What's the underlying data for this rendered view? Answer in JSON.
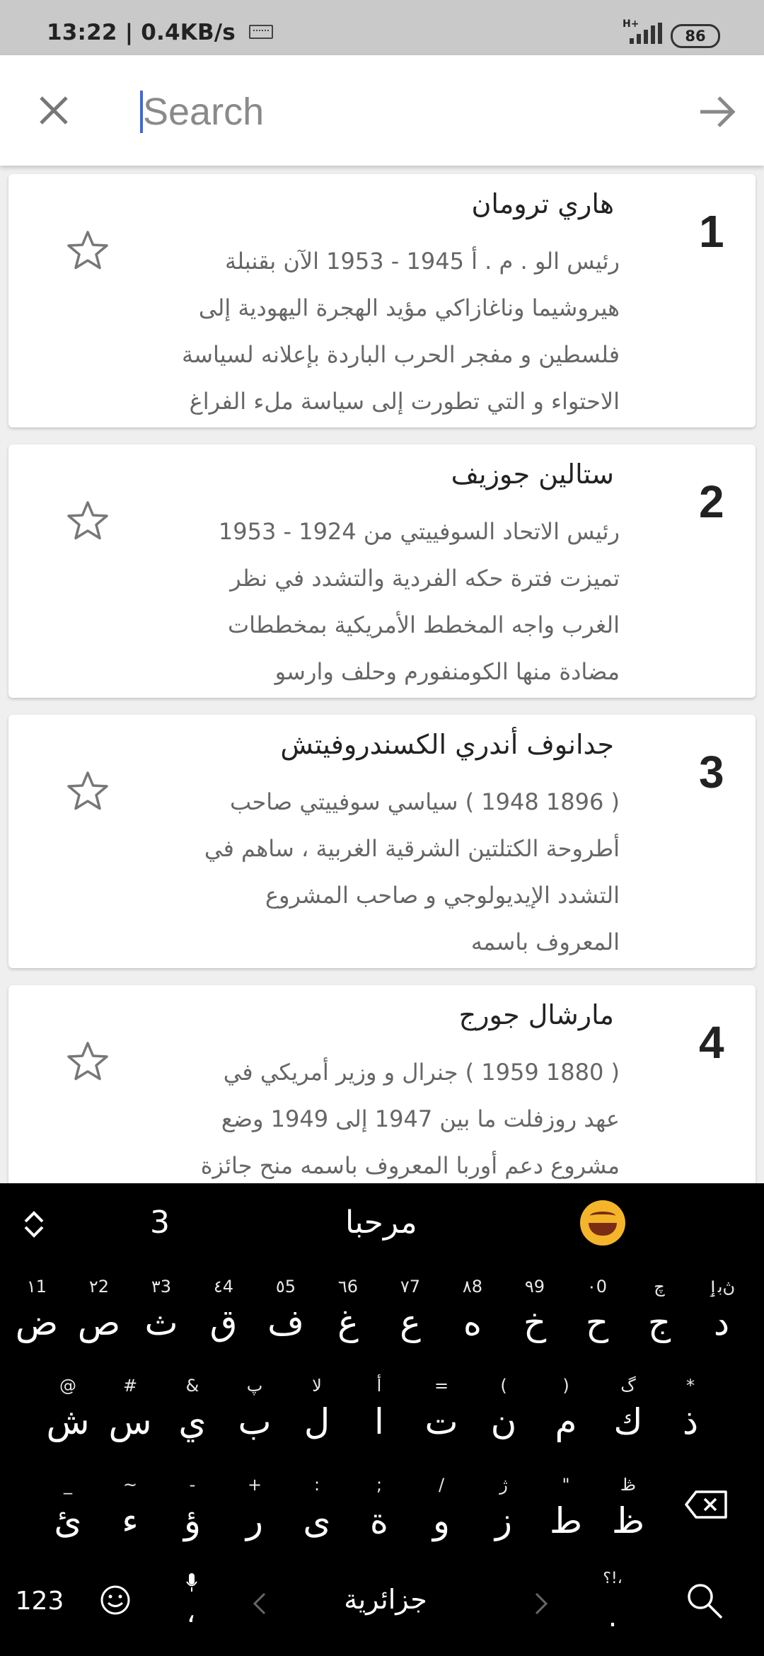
{
  "status_bar": {
    "time": "13:22",
    "speed": "0.4KB/s",
    "network": "H+",
    "battery": "86"
  },
  "search": {
    "placeholder": "Search"
  },
  "results": [
    {
      "rank": "1",
      "title": "هاري ترومان",
      "lines": [
        "رئيس الو . م . أ 1945 - 1953 الآن بقنبلة",
        "هيروشيما وناغازاكي مؤيد الهجرة اليهودية إلى",
        "فلسطين و مفجر الحرب الباردة بإعلانه لسياسة",
        "الاحتواء و التي تطورت إلى سياسة ملء الفراغ"
      ]
    },
    {
      "rank": "2",
      "title": "ستالين جوزيف",
      "lines": [
        "رئيس الاتحاد السوفييتي من 1924 - 1953",
        "تميزت فترة حكه الفردية والتشدد في نظر",
        "الغرب واجه المخطط الأمريكية بمخططات",
        "مضادة منها الكومنفورم وحلف وارسو"
      ]
    },
    {
      "rank": "3",
      "title": "جدانوف أندري الكسندروفيتش",
      "lines": [
        "( 1896 1948 ) سياسي سوفييتي صاحب",
        "أطروحة الكتلتين الشرقية الغربية ، ساهم في",
        "التشدد الإيديولوجي و صاحب المشروع",
        "المعروف باسمه"
      ]
    },
    {
      "rank": "4",
      "title": "مارشال جورج",
      "lines": [
        "( 1880 1959 ) جنرال و وزير أمريكي في",
        "عهد روزفلت ما بين 1947 إلى 1949 وضع",
        "مشروع دعم أوربا المعروف باسمه منح جائزة"
      ]
    }
  ],
  "keyboard": {
    "suggestions": [
      "3",
      "مرحبا"
    ],
    "rows": [
      [
        {
          "hint": "١1",
          "main": "ض"
        },
        {
          "hint": "٢2",
          "main": "ص"
        },
        {
          "hint": "٣3",
          "main": "ث"
        },
        {
          "hint": "٤4",
          "main": "ق"
        },
        {
          "hint": "٥5",
          "main": "ف"
        },
        {
          "hint": "٦6",
          "main": "غ"
        },
        {
          "hint": "٧7",
          "main": "ع"
        },
        {
          "hint": "٨8",
          "main": "ه"
        },
        {
          "hint": "٩9",
          "main": "خ"
        },
        {
          "hint": "٠0",
          "main": "ح"
        },
        {
          "hint": "چ",
          "main": "ج"
        },
        {
          "hint": "ڽﺑٳ",
          "main": "د"
        }
      ],
      [
        {
          "hint": "@",
          "main": "ش"
        },
        {
          "hint": "#",
          "main": "س"
        },
        {
          "hint": "&",
          "main": "ي"
        },
        {
          "hint": "پ",
          "main": "ب"
        },
        {
          "hint": "لا",
          "main": "ل"
        },
        {
          "hint": "أ",
          "main": "ا"
        },
        {
          "hint": "=",
          "main": "ت"
        },
        {
          "hint": "(",
          "main": "ن"
        },
        {
          "hint": ")",
          "main": "م"
        },
        {
          "hint": "گ",
          "main": "ك"
        },
        {
          "hint": "*",
          "main": "ذ"
        }
      ],
      [
        {
          "hint": "_",
          "main": "ئ"
        },
        {
          "hint": "~",
          "main": "ء"
        },
        {
          "hint": "-",
          "main": "ؤ"
        },
        {
          "hint": "+",
          "main": "ر"
        },
        {
          "hint": ":",
          "main": "ى"
        },
        {
          "hint": ";",
          "main": "ة"
        },
        {
          "hint": "/",
          "main": "و"
        },
        {
          "hint": "ژ",
          "main": "ز"
        },
        {
          "hint": "\"",
          "main": "ط"
        },
        {
          "hint": "ڟ",
          "main": "ظ"
        }
      ]
    ],
    "numbers_label": "123",
    "comma": "،",
    "language": "جزائرية",
    "punct_hint": "؟!،",
    "period": "."
  }
}
